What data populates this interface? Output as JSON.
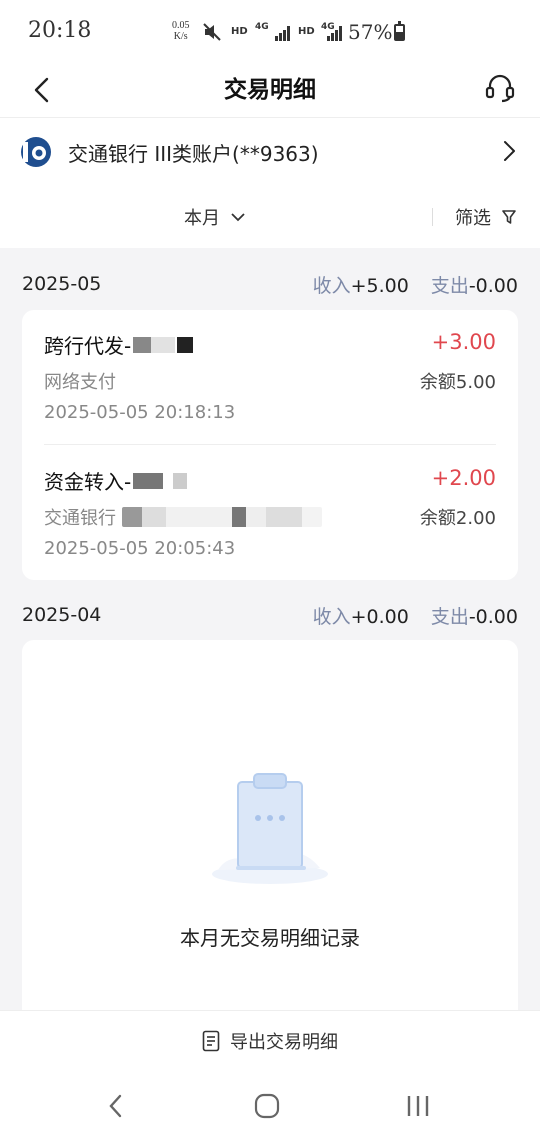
{
  "status_bar": {
    "time": "20:18",
    "speed_value": "0.05",
    "speed_unit": "K/s",
    "hd_1": "HD",
    "net_1": "4G",
    "hd_2": "HD",
    "net_2": "4G",
    "battery": "57%"
  },
  "header": {
    "title": "交易明细"
  },
  "account": {
    "name": "交通银行 III类账户(**9363)"
  },
  "filter": {
    "period_label": "本月",
    "filter_label": "筛选"
  },
  "months": [
    {
      "month": "2025-05",
      "income_label": "收入",
      "income_value": "+5.00",
      "expense_label": "支出",
      "expense_value": "-0.00",
      "transactions": [
        {
          "title": "跨行代发-",
          "amount": "+3.00",
          "channel": "网络支付",
          "balance": "余额5.00",
          "time": "2025-05-05 20:18:13"
        },
        {
          "title": "资金转入-",
          "amount": "+2.00",
          "channel": "交通银行",
          "balance": "余额2.00",
          "time": "2025-05-05 20:05:43"
        }
      ]
    },
    {
      "month": "2025-04",
      "income_label": "收入",
      "income_value": "+0.00",
      "expense_label": "支出",
      "expense_value": "-0.00",
      "empty_text": "本月无交易明细记录"
    }
  ],
  "footer": {
    "export_label": "导出交易明细"
  },
  "colors": {
    "amount_positive": "#e0474e",
    "summary_label": "#7e8aa8",
    "bank_blue": "#1f4e8f"
  }
}
